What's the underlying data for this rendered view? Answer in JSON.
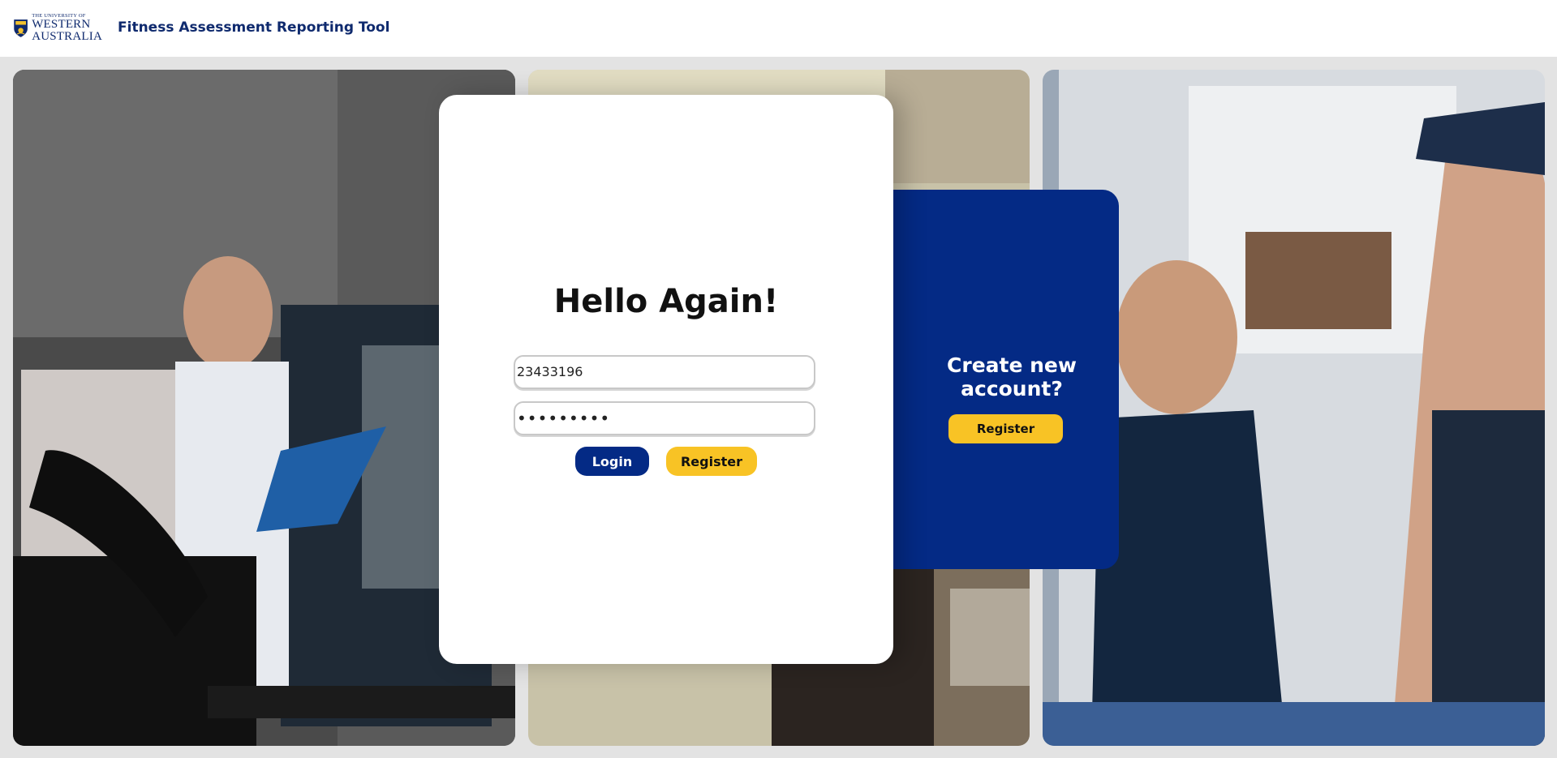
{
  "header": {
    "logo_line1": "THE UNIVERSITY OF",
    "logo_line2": "WESTERN",
    "logo_line3": "AUSTRALIA",
    "app_title": "Fitness Assessment Reporting Tool"
  },
  "login": {
    "heading": "Hello Again!",
    "id_value": "23433196",
    "password_mask": "•••••••••",
    "login_label": "Login",
    "register_label": "Register"
  },
  "signup": {
    "prompt": "Create new account?",
    "register_label": "Register"
  },
  "colors": {
    "brand_blue": "#042a85",
    "accent_yellow": "#f8c325",
    "title_blue": "#0f2a6e",
    "background": "#e3e3e3"
  },
  "icons": {
    "logo": "university-crest-icon"
  }
}
